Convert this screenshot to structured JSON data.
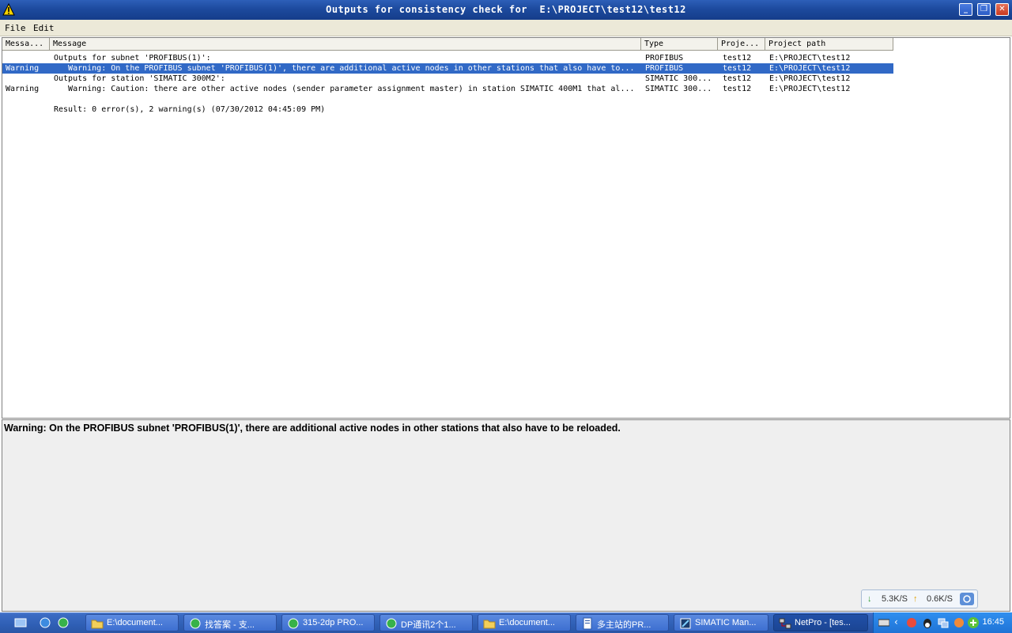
{
  "window": {
    "title": "Outputs for consistency check for  E:\\PROJECT\\test12\\test12",
    "controls": {
      "minimize": "_",
      "restore": "❐",
      "close": "✕"
    }
  },
  "menu": {
    "file": "File",
    "edit": "Edit"
  },
  "table": {
    "columns": [
      "Messa...",
      "Message",
      "Type",
      "Proje...",
      "Project path"
    ],
    "rows": [
      {
        "kind": "",
        "message": "Outputs for subnet 'PROFIBUS(1)':",
        "type": "PROFIBUS",
        "project": "test12",
        "path": "E:\\PROJECT\\test12"
      },
      {
        "kind": "Warning",
        "message": "   Warning: On the PROFIBUS subnet 'PROFIBUS(1)', there are additional active nodes in other stations that also have to...",
        "type": "PROFIBUS",
        "project": "test12",
        "path": "E:\\PROJECT\\test12"
      },
      {
        "kind": "",
        "message": "Outputs for station 'SIMATIC 300M2':",
        "type": "SIMATIC 300...",
        "project": "test12",
        "path": "E:\\PROJECT\\test12"
      },
      {
        "kind": "Warning",
        "message": "   Warning: Caution: there are other active nodes (sender parameter assignment master) in station SIMATIC 400M1 that al...",
        "type": "SIMATIC 300...",
        "project": "test12",
        "path": "E:\\PROJECT\\test12"
      },
      {
        "kind": "",
        "message": "",
        "type": "",
        "project": "",
        "path": ""
      },
      {
        "kind": "",
        "message": "Result: 0 error(s), 2 warning(s) (07/30/2012 04:45:09 PM)",
        "type": "",
        "project": "",
        "path": ""
      }
    ]
  },
  "detail": {
    "text": "Warning: On the PROFIBUS subnet 'PROFIBUS(1)', there are additional active nodes in other stations that also have to be reloaded."
  },
  "netspeed": {
    "down": "5.3K/S",
    "up": "0.6K/S"
  },
  "taskbar": {
    "tasks": [
      {
        "label": "E:\\document...",
        "icon": "folder-icon"
      },
      {
        "label": "找答案 - 支...",
        "icon": "browser-icon"
      },
      {
        "label": "315-2dp PRO...",
        "icon": "browser-icon"
      },
      {
        "label": "DP通讯2个1...",
        "icon": "browser-icon"
      },
      {
        "label": "E:\\document...",
        "icon": "folder-icon"
      },
      {
        "label": "多主站的PR...",
        "icon": "document-icon"
      },
      {
        "label": "SIMATIC Man...",
        "icon": "simatic-icon"
      },
      {
        "label": "NetPro - [tes...",
        "icon": "netpro-icon"
      }
    ],
    "clock": "16:45"
  },
  "colors": {
    "selection": "#3169c6",
    "titlebar": "#1d4a9e",
    "taskbar": "#2f5fb5"
  }
}
